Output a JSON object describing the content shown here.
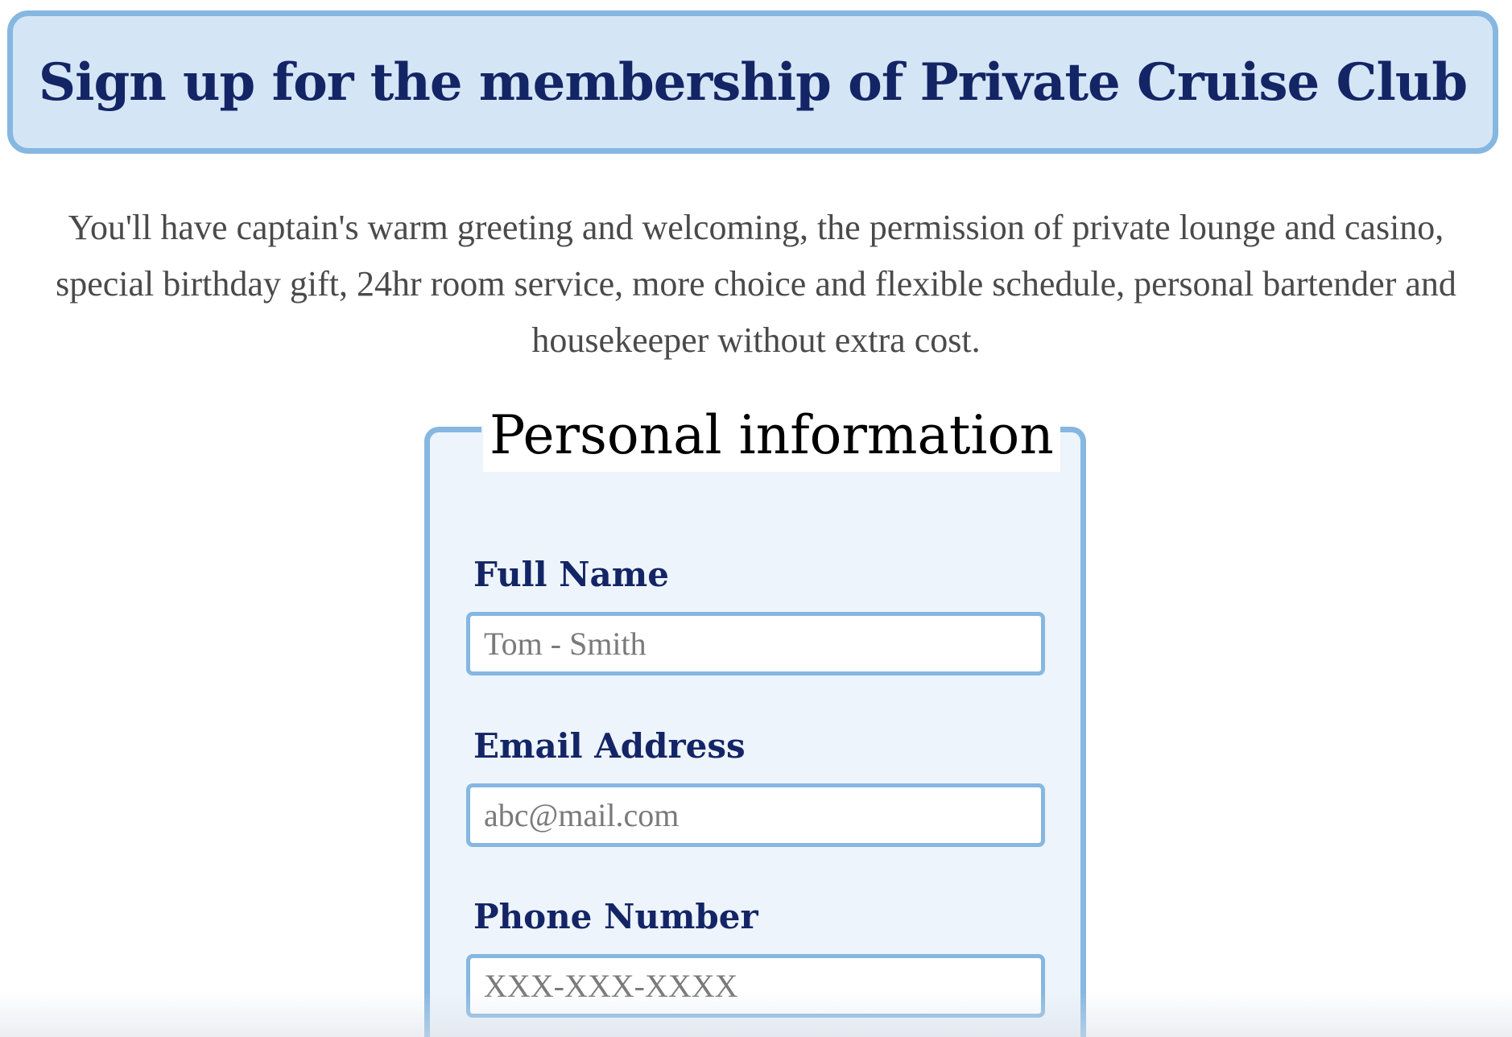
{
  "header": {
    "title": "Sign up for the membership of Private Cruise Club"
  },
  "intro": {
    "text": "You'll have captain's warm greeting and welcoming, the permission of private lounge and casino, special birthday gift, 24hr room service, more choice and flexible schedule, personal bartender and housekeeper without extra cost."
  },
  "form": {
    "legend": "Personal information",
    "fields": [
      {
        "label": "Full Name",
        "placeholder": "Tom - Smith",
        "value": ""
      },
      {
        "label": "Email Address",
        "placeholder": "abc@mail.com",
        "value": ""
      },
      {
        "label": "Phone Number",
        "placeholder": "XXX-XXX-XXXX",
        "value": ""
      }
    ]
  },
  "colors": {
    "accent_border": "#85b7e1",
    "header_background": "#d4e5f6",
    "panel_background": "#edf4fb",
    "heading_text": "#142566",
    "body_text": "#4a4a4a"
  }
}
